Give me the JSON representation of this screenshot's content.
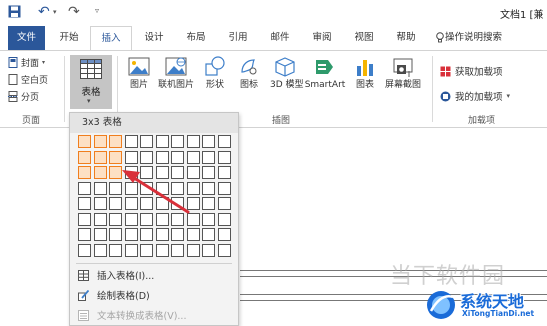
{
  "quick_access": {
    "save_icon": "save-icon",
    "undo_icon": "undo-icon",
    "redo_icon": "redo-icon",
    "customize_icon": "customize-caret-icon"
  },
  "window": {
    "title": "文档1 [兼"
  },
  "tabs": {
    "file": "文件",
    "items": [
      "开始",
      "插入",
      "设计",
      "布局",
      "引用",
      "邮件",
      "审阅",
      "视图",
      "帮助"
    ],
    "active": "插入",
    "search": "操作说明搜索"
  },
  "ribbon": {
    "pages_group": {
      "label": "页面",
      "cover": "封面",
      "blank": "空白页",
      "break": "分页"
    },
    "table_button": {
      "label": "表格"
    },
    "illustrations_group": {
      "label": "插图",
      "buttons": [
        {
          "label": "图片",
          "icon": "picture-icon"
        },
        {
          "label": "联机图片",
          "icon": "online-picture-icon"
        },
        {
          "label": "形状",
          "icon": "shapes-icon"
        },
        {
          "label": "图标",
          "icon": "icons-icon"
        },
        {
          "label": "3D 模型",
          "icon": "3d-model-icon"
        },
        {
          "label": "SmartArt",
          "icon": "smartart-icon"
        },
        {
          "label": "图表",
          "icon": "chart-icon"
        },
        {
          "label": "屏幕截图",
          "icon": "screenshot-icon"
        }
      ]
    },
    "addins_group": {
      "label": "加载项",
      "get": "获取加载项",
      "mine": "我的加载项"
    }
  },
  "table_dropdown": {
    "header": "3x3 表格",
    "grid_cols": 10,
    "grid_rows": 8,
    "selected_cols": 3,
    "selected_rows": 3,
    "items": [
      {
        "label": "插入表格(I)...",
        "enabled": true
      },
      {
        "label": "绘制表格(D)",
        "enabled": true
      },
      {
        "label": "文本转换成表格(V)...",
        "enabled": false
      }
    ]
  },
  "watermark": {
    "text": "当下软件园",
    "badge_title": "系统天地",
    "badge_sub": "XiTongTianDi.net"
  },
  "colors": {
    "brand": "#2b579a",
    "selection_border": "#f07e1e",
    "selection_fill": "#fde0c4",
    "arrow": "#d9303a"
  }
}
